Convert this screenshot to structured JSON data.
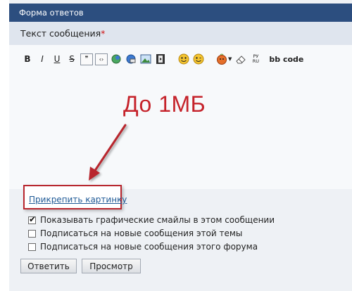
{
  "panel": {
    "title": "Форма ответов"
  },
  "message": {
    "label": "Текст сообщения",
    "required_mark": "*"
  },
  "toolbar": {
    "bold": "B",
    "italic": "I",
    "underline": "U",
    "strike": "S",
    "quote_icon": "quote-icon",
    "code_icon": "code-brackets-icon",
    "bbcode_label": "bb code",
    "translit_label": "РУ\nRU"
  },
  "annotation": {
    "text": "До 1МБ"
  },
  "attach": {
    "link_label": "Прикрепить картинку"
  },
  "options": [
    {
      "label": "Показывать графические смайлы в этом сообщении",
      "checked": true
    },
    {
      "label": "Подписаться на новые сообщения этой темы",
      "checked": false
    },
    {
      "label": "Подписаться на новые сообщения этого форума",
      "checked": false
    }
  ],
  "buttons": {
    "reply": "Ответить",
    "preview": "Просмотр"
  },
  "colors": {
    "title_bar": "#2c4e7f",
    "subhead": "#dfe5ee",
    "annotation": "#c5222a",
    "link": "#1f5a96"
  }
}
